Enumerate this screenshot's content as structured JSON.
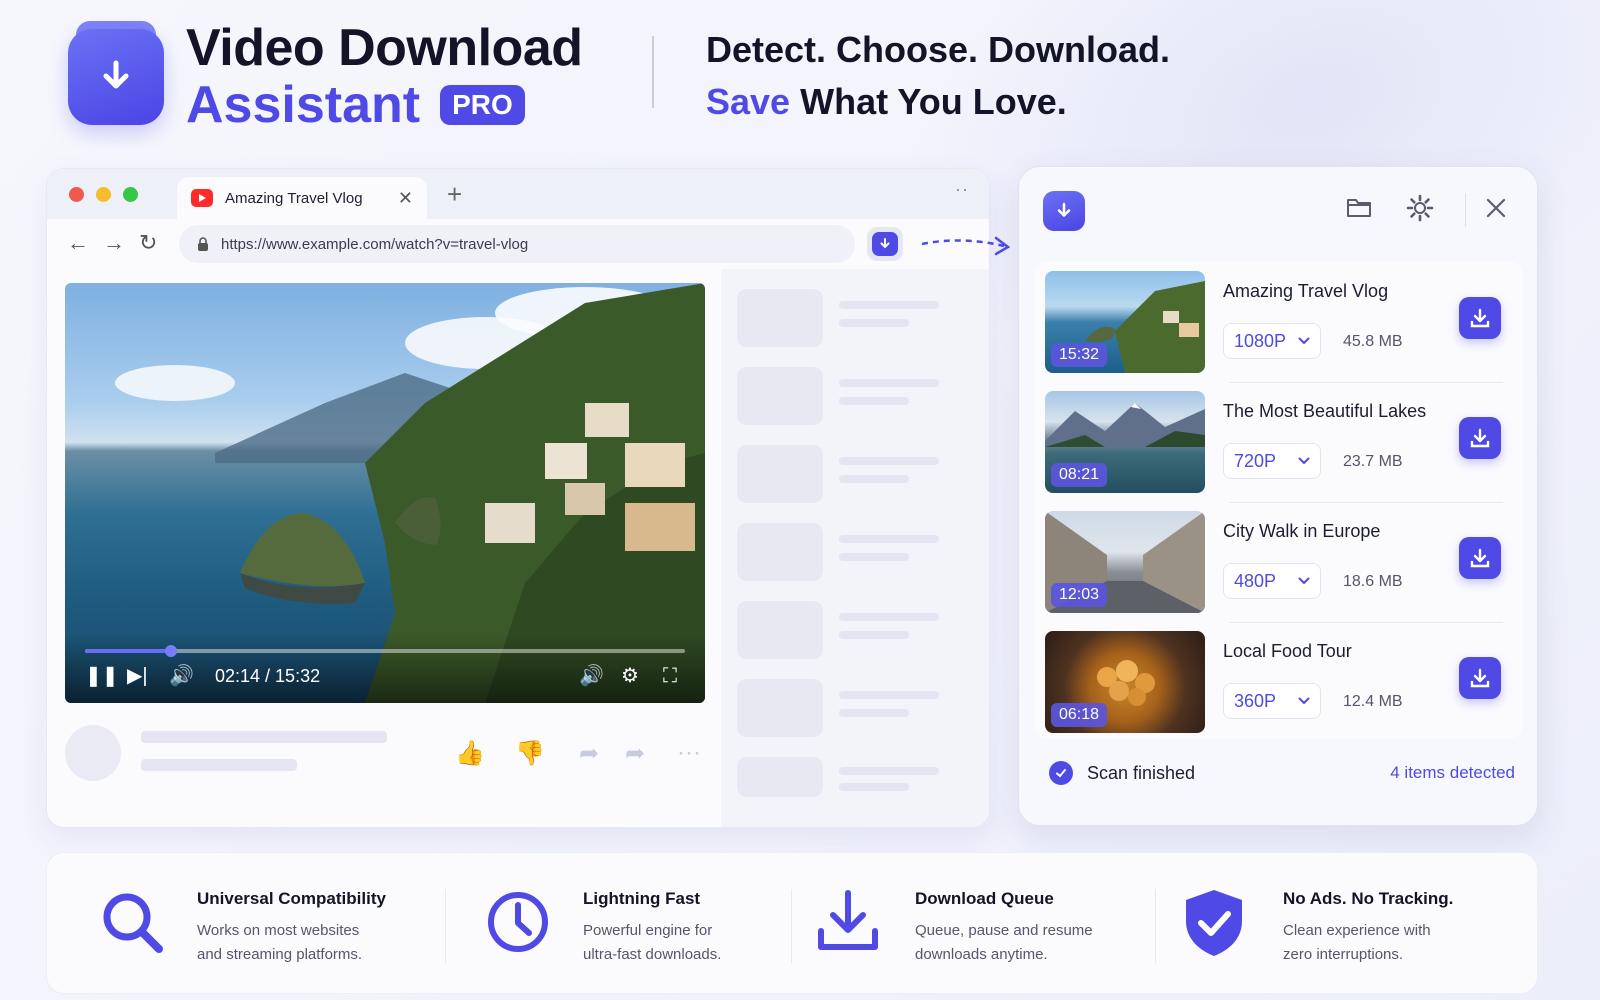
{
  "header": {
    "title_line1": "Video Download",
    "title_line2": "Assistant",
    "badge": "PRO",
    "tagline_line1": "Detect. Choose. Download.",
    "tagline_accent": "Save",
    "tagline_rest": "What You Love."
  },
  "browser": {
    "tab_title": "Amazing Travel Vlog",
    "url": "https://www.example.com/watch?v=travel-vlog",
    "player": {
      "time": "02:14 / 15:32",
      "progress_fraction": 0.144
    }
  },
  "panel": {
    "items": [
      {
        "title": "Amazing Travel Vlog",
        "duration": "15:32",
        "quality": "1080P",
        "size": "45.8 MB",
        "thumb": "coast"
      },
      {
        "title": "The Most Beautiful Lakes",
        "duration": "08:21",
        "quality": "720P",
        "size": "23.7 MB",
        "thumb": "lake"
      },
      {
        "title": "City Walk in Europe",
        "duration": "12:03",
        "quality": "480P",
        "size": "18.6 MB",
        "thumb": "city"
      },
      {
        "title": "Local Food Tour",
        "duration": "06:18",
        "quality": "360P",
        "size": "12.4 MB",
        "thumb": "food"
      }
    ],
    "status_text": "Scan finished",
    "detected_text": "4 items detected"
  },
  "features": [
    {
      "title": "Universal Compatibility",
      "desc_line1": "Works on most websites",
      "desc_line2": "and streaming platforms.",
      "icon": "search-icon"
    },
    {
      "title": "Lightning Fast",
      "desc_line1": "Powerful engine for",
      "desc_line2": "ultra-fast downloads.",
      "icon": "clock-icon"
    },
    {
      "title": "Download Queue",
      "desc_line1": "Queue, pause and resume",
      "desc_line2": "downloads anytime.",
      "icon": "download-tray-icon"
    },
    {
      "title": "No Ads. No Tracking.",
      "desc_line1": "Clean experience with",
      "desc_line2": "zero interruptions.",
      "icon": "shield-check-icon"
    }
  ],
  "colors": {
    "accent": "#4f4ae6",
    "youtube": "#ff2a2a"
  }
}
